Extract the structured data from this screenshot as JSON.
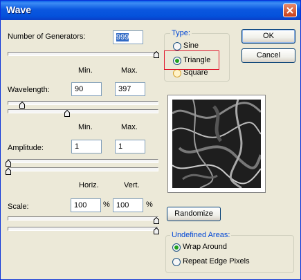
{
  "window": {
    "title": "Wave"
  },
  "generators": {
    "label": "Number of Generators:",
    "value": "999"
  },
  "wavelength": {
    "label": "Wavelength:",
    "min_header": "Min.",
    "max_header": "Max.",
    "min": "90",
    "max": "397"
  },
  "amplitude": {
    "label": "Amplitude:",
    "min_header": "Min.",
    "max_header": "Max.",
    "min": "1",
    "max": "1"
  },
  "scale": {
    "label": "Scale:",
    "horiz_header": "Horiz.",
    "vert_header": "Vert.",
    "horiz": "100",
    "vert": "100",
    "unit": "%"
  },
  "type": {
    "title": "Type:",
    "options": [
      {
        "label": "Sine",
        "checked": false
      },
      {
        "label": "Triangle",
        "checked": true
      },
      {
        "label": "Square",
        "checked": false
      }
    ]
  },
  "buttons": {
    "ok": "OK",
    "cancel": "Cancel",
    "randomize": "Randomize"
  },
  "undefined_areas": {
    "title": "Undefined Areas:",
    "options": [
      {
        "label": "Wrap Around",
        "checked": true
      },
      {
        "label": "Repeat Edge Pixels",
        "checked": false
      }
    ]
  },
  "colors": {
    "title_bar": "#0a5fe8",
    "dialog_bg": "#ece9d8",
    "group_title": "#0046d5",
    "highlight": "#e0142a"
  }
}
